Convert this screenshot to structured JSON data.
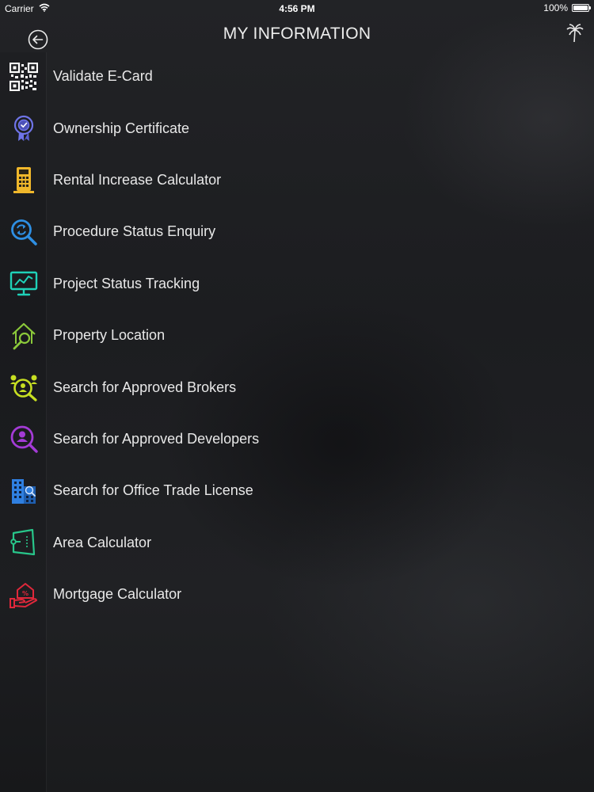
{
  "status_bar": {
    "carrier": "Carrier",
    "time": "4:56 PM",
    "battery": "100%",
    "battery_level": 1.0
  },
  "nav": {
    "title": "MY INFORMATION",
    "back_icon": "back-arrow-icon",
    "right_icon": "palm-tree-icon"
  },
  "menu": {
    "items": [
      {
        "label": "Validate E-Card",
        "icon": "qr-code-icon",
        "color": "#ffffff"
      },
      {
        "label": "Ownership Certificate",
        "icon": "certificate-badge-icon",
        "color": "#6f74e8"
      },
      {
        "label": "Rental Increase Calculator",
        "icon": "calculator-icon",
        "color": "#f0b72b"
      },
      {
        "label": "Procedure Status Enquiry",
        "icon": "search-refresh-icon",
        "color": "#2e8fe3"
      },
      {
        "label": "Project Status Tracking",
        "icon": "monitor-chart-icon",
        "color": "#1fd1b8"
      },
      {
        "label": "Property Location",
        "icon": "house-search-icon",
        "color": "#8bc93a"
      },
      {
        "label": "Search for Approved Brokers",
        "icon": "broker-search-icon",
        "color": "#c7df22"
      },
      {
        "label": "Search for Approved Developers",
        "icon": "developer-search-icon",
        "color": "#a43bd6"
      },
      {
        "label": "Search for Office Trade License",
        "icon": "office-building-icon",
        "color": "#2f7fe0"
      },
      {
        "label": "Area Calculator",
        "icon": "area-plan-icon",
        "color": "#28c68a"
      },
      {
        "label": "Mortgage Calculator",
        "icon": "mortgage-hand-icon",
        "color": "#e0283b"
      }
    ]
  }
}
